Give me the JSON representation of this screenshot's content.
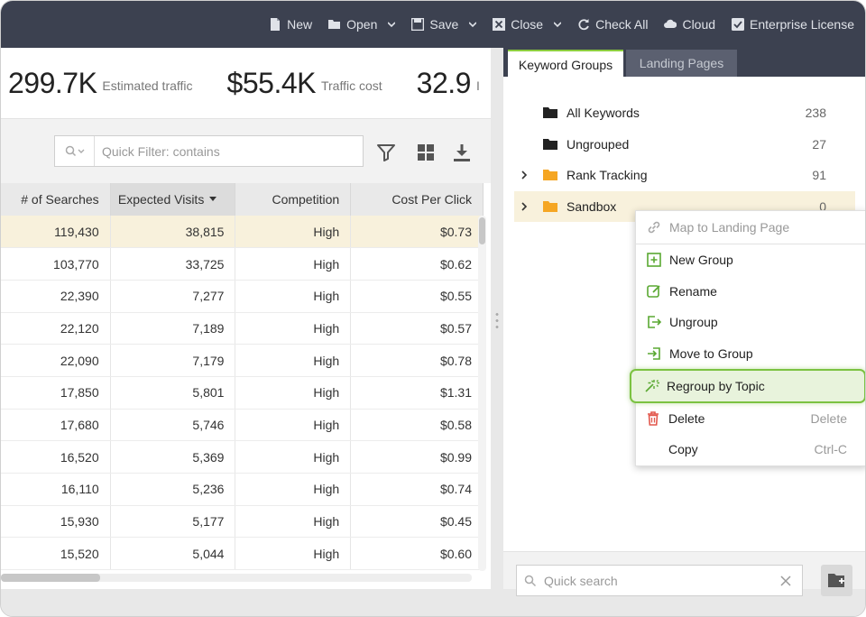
{
  "toolbar": {
    "items": [
      {
        "label": "New",
        "icon": "file-icon"
      },
      {
        "label": "Open",
        "icon": "folder-open-icon",
        "dropdown": true
      },
      {
        "label": "Save",
        "icon": "save-icon",
        "dropdown": true
      },
      {
        "label": "Close",
        "icon": "close-box-icon",
        "dropdown": true
      },
      {
        "label": "Check All",
        "icon": "refresh-icon"
      },
      {
        "label": "Cloud",
        "icon": "cloud-icon"
      },
      {
        "label": "Enterprise License",
        "icon": "checkbox-icon"
      }
    ]
  },
  "stats": [
    {
      "value": "299.7K",
      "label": "Estimated traffic"
    },
    {
      "value": "$55.4K",
      "label": "Traffic cost"
    },
    {
      "value": "32.9",
      "label": "I"
    }
  ],
  "filter": {
    "placeholder": "Quick Filter: contains"
  },
  "grid": {
    "columns": [
      "# of Searches",
      "Expected Visits",
      "Competition",
      "Cost Per Click"
    ],
    "rows": [
      [
        "119,430",
        "38,815",
        "High",
        "$0.73"
      ],
      [
        "103,770",
        "33,725",
        "High",
        "$0.62"
      ],
      [
        "22,390",
        "7,277",
        "High",
        "$0.55"
      ],
      [
        "22,120",
        "7,189",
        "High",
        "$0.57"
      ],
      [
        "22,090",
        "7,179",
        "High",
        "$0.78"
      ],
      [
        "17,850",
        "5,801",
        "High",
        "$1.31"
      ],
      [
        "17,680",
        "5,746",
        "High",
        "$0.58"
      ],
      [
        "16,520",
        "5,369",
        "High",
        "$0.99"
      ],
      [
        "16,110",
        "5,236",
        "High",
        "$0.74"
      ],
      [
        "15,930",
        "5,177",
        "High",
        "$0.45"
      ],
      [
        "15,520",
        "5,044",
        "High",
        "$0.60"
      ]
    ]
  },
  "tabs": [
    {
      "label": "Keyword Groups",
      "active": true
    },
    {
      "label": "Landing Pages",
      "active": false
    }
  ],
  "tree": [
    {
      "label": "All Keywords",
      "count": "238",
      "folder_color": "#222222"
    },
    {
      "label": "Ungrouped",
      "count": "27",
      "folder_color": "#222222"
    },
    {
      "label": "Rank Tracking",
      "count": "91",
      "folder_color": "#f5a623"
    },
    {
      "label": "Sandbox",
      "count": "0",
      "folder_color": "#f5a623"
    }
  ],
  "context_menu": {
    "items": [
      {
        "label": "Map to Landing Page",
        "shortcut": "",
        "icon": "link-icon"
      },
      {
        "label": "New Group",
        "shortcut": "",
        "icon": "new-group-icon"
      },
      {
        "label": "Rename",
        "shortcut": "",
        "icon": "edit-icon"
      },
      {
        "label": "Ungroup",
        "shortcut": "",
        "icon": "ungroup-icon"
      },
      {
        "label": "Move to Group",
        "shortcut": "",
        "icon": "move-icon"
      },
      {
        "label": "Regroup by Topic",
        "shortcut": "",
        "icon": "magic-wand-icon"
      },
      {
        "label": "Delete",
        "shortcut": "Delete",
        "icon": "trash-icon"
      },
      {
        "label": "Copy",
        "shortcut": "Ctrl-C",
        "icon": ""
      }
    ]
  },
  "quick_search": {
    "placeholder": "Quick search"
  },
  "colors": {
    "toolbar": "#3c4150",
    "accent": "#7bc241",
    "selection": "#f8f1dc",
    "folder_orange": "#f5a623"
  }
}
